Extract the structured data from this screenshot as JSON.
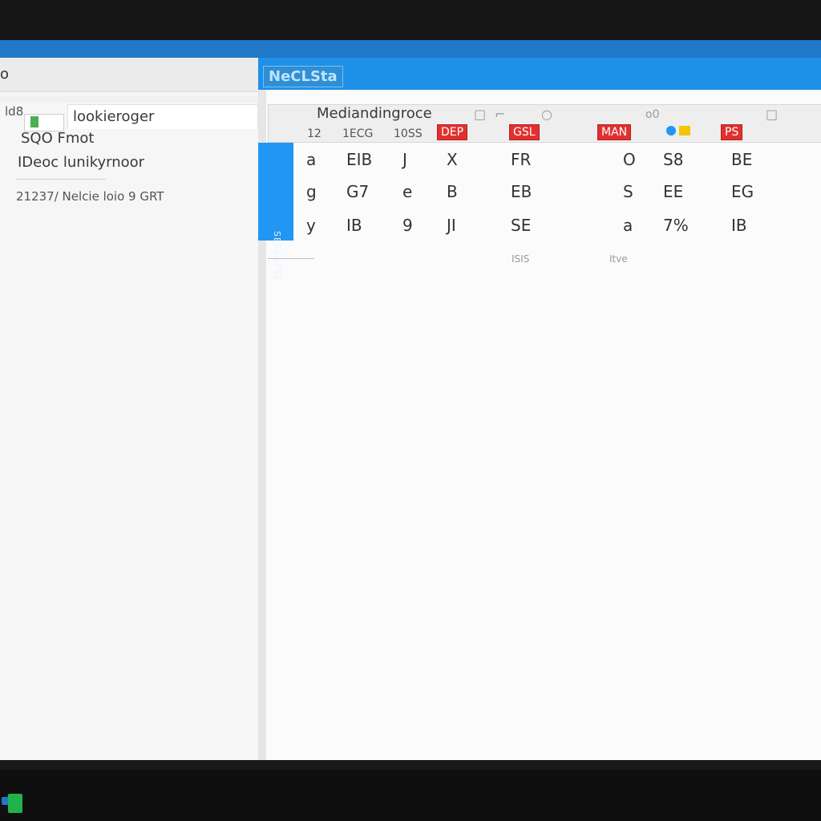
{
  "left": {
    "title": "o",
    "row0": "ld8",
    "row1_value": "lookieroger",
    "row2": "SQO Fmot",
    "row3": "IDeoc lunikyrnoor",
    "row4": "21237/ Nelcie loio 9 GRT"
  },
  "right": {
    "header": "NeCLSta",
    "toolbar": {
      "title": "Mediandingroce",
      "small1": "12",
      "small2": "1ECG",
      "small3": "10SS",
      "red1": "DEP",
      "red2": "GSL",
      "red3": "MAN",
      "red4": "PS",
      "icon_text": "o0"
    },
    "grid": [
      [
        "a",
        "EIB",
        "J",
        "X",
        "FR",
        "O",
        "S8",
        "BE"
      ],
      [
        "g",
        "G7",
        "e",
        "B",
        "EB",
        "S",
        "EE",
        "EG"
      ],
      [
        "y",
        "IB",
        "9",
        "JI",
        "SE",
        "a",
        "7%",
        "IB"
      ]
    ],
    "footer": {
      "small1": "ISIS",
      "small2": "Itve"
    },
    "blue_side": "SESESESE"
  },
  "colors": {
    "accent": "#1e90e8",
    "red": "#e03030",
    "green": "#22b24c"
  }
}
